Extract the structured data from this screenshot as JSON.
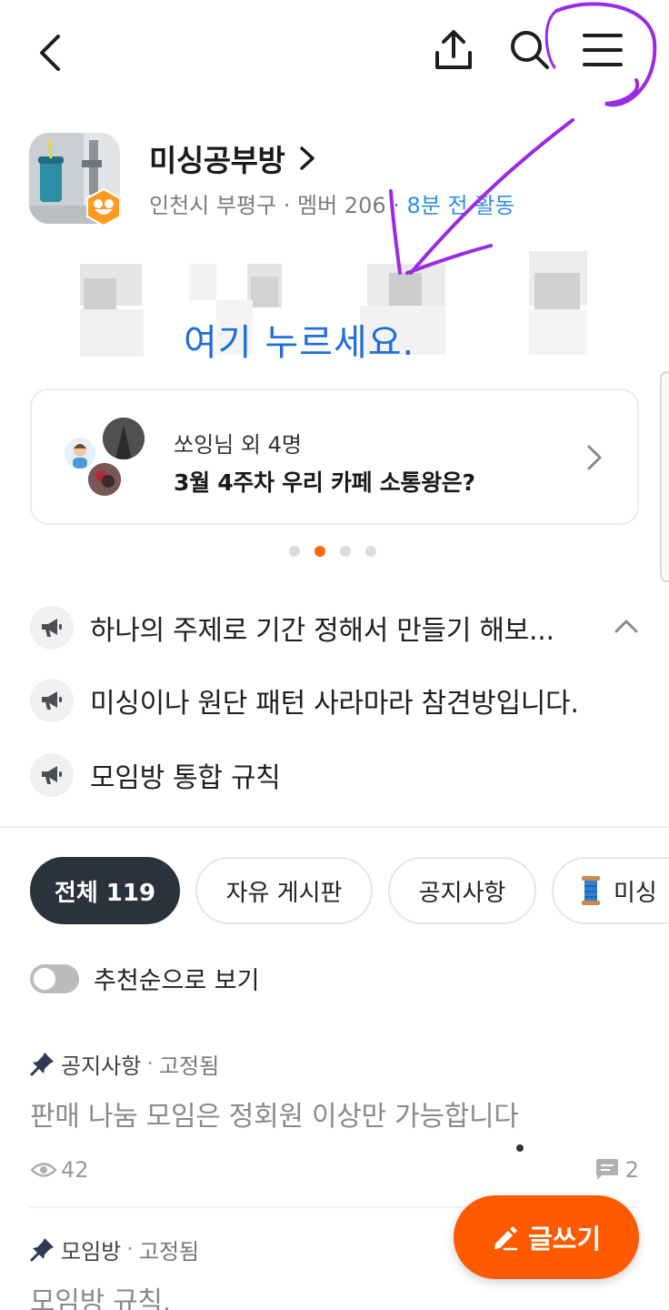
{
  "cafe": {
    "name": "미싱공부방",
    "location": "인천시 부평구",
    "members_label": "멤버 206",
    "active_label": "8분 전 활동"
  },
  "banner": {
    "text": "여기 누르세요."
  },
  "ranking": {
    "subtitle": "쏘잉님 외 4명",
    "title": "3월 4주차 우리 카페 소통왕은?"
  },
  "carousel": {
    "count": 4,
    "active_index": 1
  },
  "notices": [
    {
      "text": "하나의 주제로 기간 정해서 만들기 해보..."
    },
    {
      "text": "미싱이나 원단 패턴 사라마라 참견방입니다."
    },
    {
      "text": "모임방 통합 규칙"
    }
  ],
  "tabs": [
    {
      "label": "전체 119",
      "active": true
    },
    {
      "label": "자유 게시판",
      "active": false
    },
    {
      "label": "공지사항",
      "active": false
    },
    {
      "label": "미싱",
      "active": false
    }
  ],
  "toggle": {
    "label": "추천순으로 보기",
    "on": false
  },
  "posts": [
    {
      "board": "공지사항",
      "pinned_label": "고정됨",
      "title": "판매 나눔 모임은 정회원 이상만 가능합니다",
      "views": "42",
      "comments": "2"
    },
    {
      "board": "모임방",
      "pinned_label": "고정됨",
      "title": "모임방 규칙."
    }
  ],
  "fab": {
    "label": "글쓰기"
  },
  "colors": {
    "accent_orange": "#ff5a00",
    "active_blue": "#2f8dea",
    "tab_active_bg": "#2a323b",
    "annotation_purple": "#9a2be2"
  },
  "icons": [
    "back-arrow-icon",
    "share-icon",
    "search-icon",
    "menu-icon",
    "megaphone-icon",
    "pin-icon",
    "eye-icon",
    "comment-icon",
    "pencil-icon",
    "spool-icon"
  ]
}
